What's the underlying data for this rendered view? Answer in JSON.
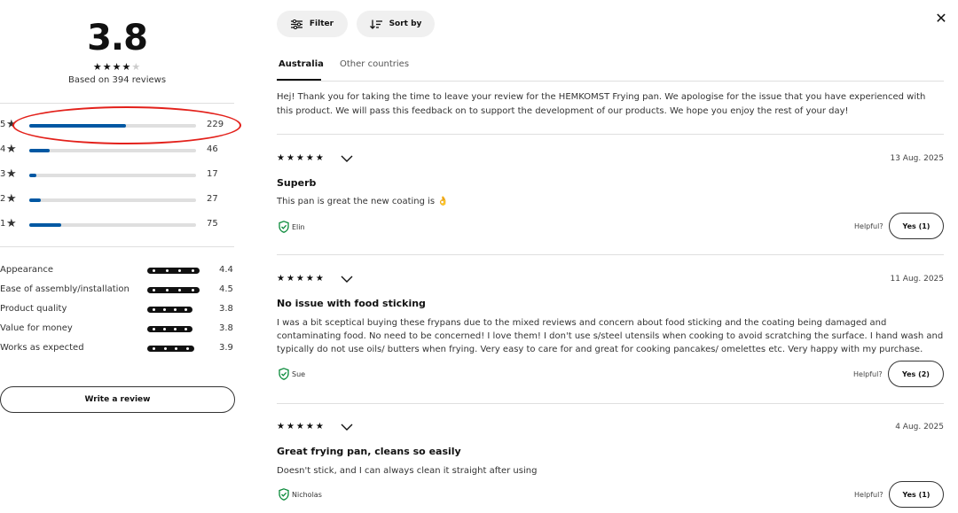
{
  "summary": {
    "rating": "3.8",
    "stars_filled": 4,
    "stars_total": 5,
    "based_on": "Based on 394 reviews",
    "distribution": [
      {
        "star": "5",
        "count": "229",
        "fraction": 0.58
      },
      {
        "star": "4",
        "count": "46",
        "fraction": 0.12
      },
      {
        "star": "3",
        "count": "17",
        "fraction": 0.04
      },
      {
        "star": "2",
        "count": "27",
        "fraction": 0.07
      },
      {
        "star": "1",
        "count": "75",
        "fraction": 0.19
      }
    ],
    "attributes": [
      {
        "label": "Appearance",
        "score": "4.4",
        "fraction": 1.0
      },
      {
        "label": "Ease of assembly/installation",
        "score": "4.5",
        "fraction": 1.0
      },
      {
        "label": "Product quality",
        "score": "3.8",
        "fraction": 0.87
      },
      {
        "label": "Value for money",
        "score": "3.8",
        "fraction": 0.87
      },
      {
        "label": "Works as expected",
        "score": "3.9",
        "fraction": 0.9
      }
    ],
    "write_review_label": "Write a review",
    "highlight_color": "#e3211b"
  },
  "toolbar": {
    "filter_label": "Filter",
    "sort_label": "Sort by",
    "close_icon": "close-icon"
  },
  "tabs": [
    {
      "label": "Australia",
      "active": true
    },
    {
      "label": "Other countries",
      "active": false
    }
  ],
  "reply_text": "Hej! Thank you for taking the time to leave your review for the HEMKOMST Frying pan. We apologise for the issue that you have experienced with this product. We will pass this feedback on to support the development of our products. We hope you enjoy the rest of your day!",
  "reviews": [
    {
      "stars": "★★★★★",
      "date": "13 Aug. 2025",
      "title": "Superb",
      "body": "This pan is great the new coating is 👌",
      "reviewer": "Elin",
      "helpful_label": "Helpful?",
      "yes_label": "Yes (1)"
    },
    {
      "stars": "★★★★★",
      "date": "11 Aug. 2025",
      "title": "No issue with food sticking",
      "body": "I was a bit sceptical buying these frypans due to the mixed reviews and concern about food sticking and the coating being damaged and contaminating food. No need to be concerned! I love them! I don't use s/steel utensils when cooking to avoid scratching the surface. I hand wash and typically do not use oils/ butters when frying. Very easy to care for and great for cooking pancakes/ omelettes etc. Very happy with my purchase.",
      "reviewer": "Sue",
      "helpful_label": "Helpful?",
      "yes_label": "Yes (2)"
    },
    {
      "stars": "★★★★★",
      "date": "4 Aug. 2025",
      "title": "Great frying pan, cleans so easily",
      "body": "Doesn't stick, and I can always clean it straight after using",
      "reviewer": "Nicholas",
      "helpful_label": "Helpful?",
      "yes_label": "Yes (1)"
    }
  ],
  "colors": {
    "accent_blue": "#0058a3",
    "verified_green": "#0a8a3a"
  }
}
